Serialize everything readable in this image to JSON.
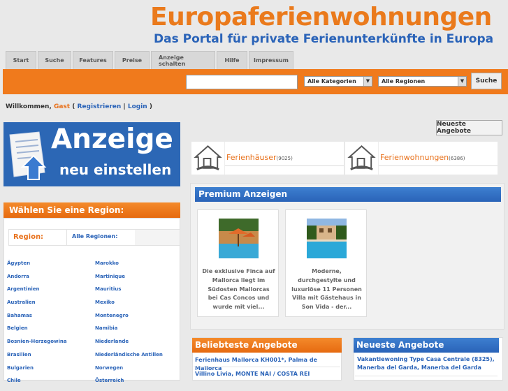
{
  "header": {
    "title": "Europaferienwohnungen",
    "subtitle": "Das Portal für private Ferienunterkünfte in Europa"
  },
  "nav": {
    "tabs": [
      {
        "label": "Start"
      },
      {
        "label": "Suche"
      },
      {
        "label": "Features"
      },
      {
        "label": "Preise"
      },
      {
        "label": "Anzeige schalten"
      },
      {
        "label": "Hilfe"
      },
      {
        "label": "Impressum"
      }
    ]
  },
  "search": {
    "query_value": "",
    "category_selected": "Alle Kategorien",
    "region_selected": "Alle Regionen",
    "button_label": "Suche"
  },
  "welcome": {
    "greeting": "Willkommen,",
    "user": "Gast",
    "open": "(",
    "register": "Registrieren",
    "sep": "|",
    "login": "Login",
    "close": ")"
  },
  "newest_button": "Neueste Angebote",
  "banner": {
    "line1": "Anzeige",
    "line2": "neu einstellen"
  },
  "region": {
    "heading": "Wählen Sie eine Region:",
    "crumb_label": "Region:",
    "crumb_value": "Alle Regionen:",
    "col1": [
      "Ägypten",
      "Andorra",
      "Argentinien",
      "Australien",
      "Bahamas",
      "Belgien",
      "Bosnien-Herzegowina",
      "Brasilien",
      "Bulgarien",
      "Chile"
    ],
    "col2": [
      "Marokko",
      "Martinique",
      "Mauritius",
      "Mexiko",
      "Montenegro",
      "Namibia",
      "Niederlande",
      "Niederländische Antillen",
      "Norwegen",
      "Österreich"
    ]
  },
  "categories": [
    {
      "label": "Ferienhäuser",
      "count": "(9025)"
    },
    {
      "label": "Ferienwohnungen",
      "count": "(6386)"
    }
  ],
  "premium": {
    "heading": "Premium Anzeigen",
    "cards": [
      {
        "text": "Die exklusive Finca auf Mallorca liegt im Südosten Mallorcas bei Cas Concos und wurde mit viel..."
      },
      {
        "text": "Moderne, durchgestylte und luxuriöse 11 Personen Villa mit Gästehaus in Son Vida - der..."
      }
    ]
  },
  "popular": {
    "heading": "Beliebteste Angebote",
    "items": [
      "Ferienhaus Mallorca KH001*, Palma de Mallorca",
      "Villino Livia, MONTE NAI / COSTA REI"
    ]
  },
  "newest": {
    "heading": "Neueste Angebote",
    "items": [
      "Vakantiewoning Type Casa Centrale (8325), Manerba del Garda, Manerba del Garda"
    ]
  },
  "colors": {
    "orange": "#f07a1c",
    "blue": "#2a63b8"
  }
}
